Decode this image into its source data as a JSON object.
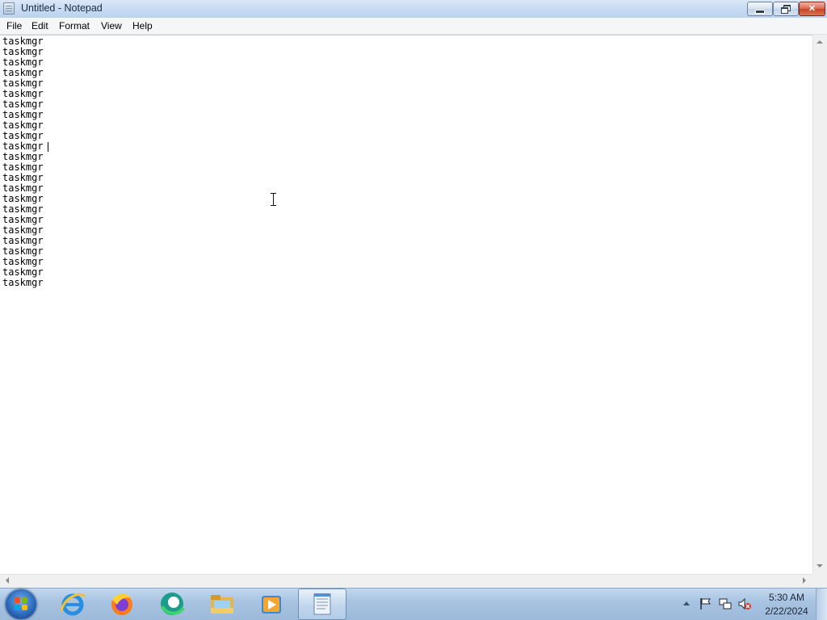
{
  "window": {
    "title": "Untitled - Notepad",
    "buttons": {
      "minimize_icon": "minimize-icon",
      "restore_icon": "restore-icon",
      "close_icon": "close-icon",
      "close_glyph": "✕"
    }
  },
  "menu": [
    "File",
    "Edit",
    "Format",
    "View",
    "Help"
  ],
  "editor": {
    "lines": [
      "taskmgr",
      "taskmgr",
      "taskmgr",
      "taskmgr",
      "taskmgr",
      "taskmgr",
      "taskmgr",
      "taskmgr",
      "taskmgr",
      "taskmgr",
      "taskmgr",
      "taskmgr",
      "taskmgr",
      "taskmgr",
      "taskmgr",
      "taskmgr",
      "taskmgr",
      "taskmgr",
      "taskmgr",
      "taskmgr",
      "taskmgr",
      "taskmgr",
      "taskmgr",
      "taskmgr"
    ]
  },
  "taskbar": {
    "pinned": [
      {
        "name": "internet-explorer-icon"
      },
      {
        "name": "firefox-icon"
      },
      {
        "name": "edge-icon"
      },
      {
        "name": "file-explorer-icon"
      },
      {
        "name": "media-player-icon"
      },
      {
        "name": "notepad-icon",
        "active": true
      }
    ],
    "tray": {
      "icons": [
        "show-hidden-icons-icon",
        "action-center-flag-icon",
        "network-icon",
        "volume-muted-icon"
      ]
    },
    "clock": {
      "time": "5:30 AM",
      "date": "2/22/2024"
    }
  },
  "colors": {
    "titlebar": "#c9dcf3",
    "close_button": "#c7421f",
    "taskbar": "#a9c4e2",
    "start_orb": "#2d6bbd"
  }
}
